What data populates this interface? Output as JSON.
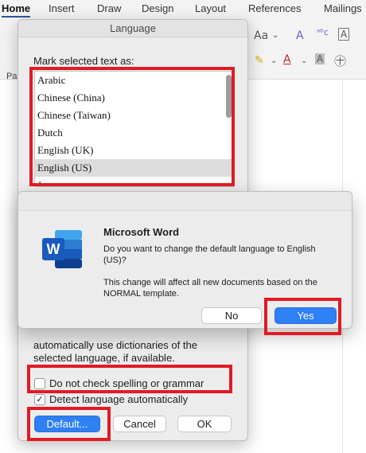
{
  "ribbon": {
    "tabs": [
      "Home",
      "Insert",
      "Draw",
      "Design",
      "Layout",
      "References",
      "Mailings"
    ],
    "paste_label": "Pa"
  },
  "language_dialog": {
    "title": "Language",
    "mark_label": "Mark selected text as:",
    "languages": [
      "Arabic",
      "Chinese (China)",
      "Chinese (Taiwan)",
      "Dutch",
      "English (UK)",
      "English (US)",
      "Japanese"
    ],
    "selected_language": "English (US)",
    "auto_text": "automatically use dictionaries of the selected language, if available.",
    "no_check_label": "Do not check spelling or grammar",
    "no_check_checked": false,
    "detect_label": "Detect language automatically",
    "detect_checked": true,
    "default_button": "Default...",
    "cancel_button": "Cancel",
    "ok_button": "OK"
  },
  "alert": {
    "title": "Microsoft Word",
    "message": "Do you want to change the default language to English (US)?",
    "note": "This change will affect all new documents based on the NORMAL template.",
    "no_button": "No",
    "yes_button": "Yes"
  },
  "colors": {
    "highlight": "#e01b24",
    "accent": "#2f7ff5",
    "word_blue": "#2b579a"
  }
}
